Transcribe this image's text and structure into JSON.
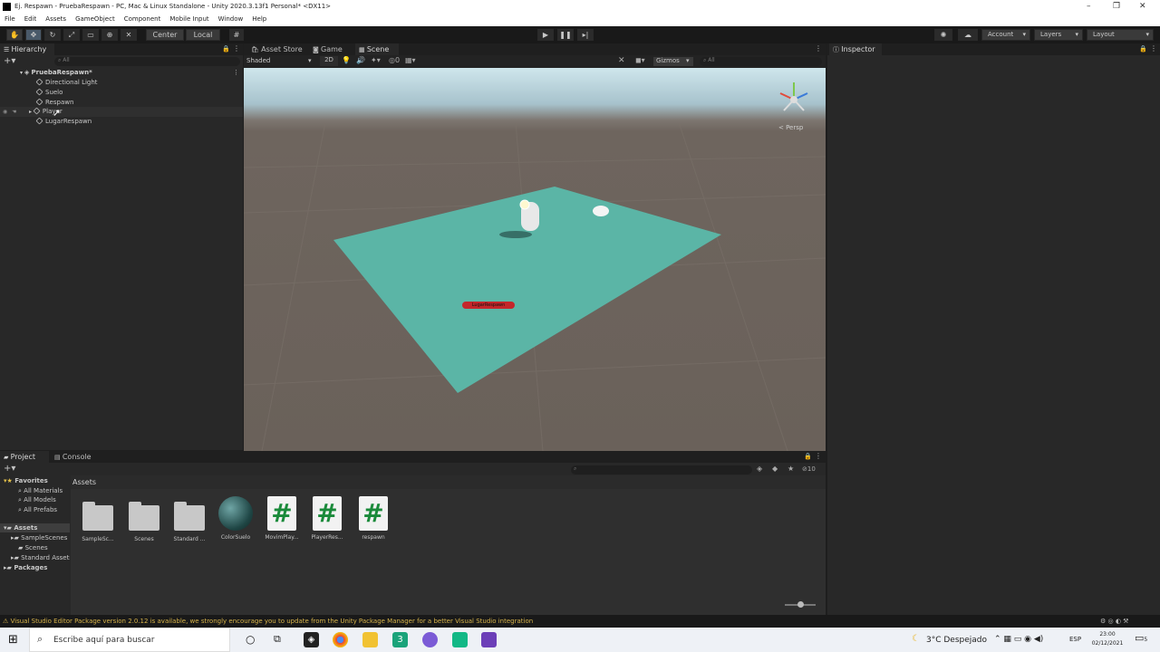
{
  "window": {
    "title": "Ej. Respawn - PruebaRespawn - PC, Mac & Linux Standalone - Unity 2020.3.13f1 Personal* <DX11>",
    "controls": [
      "–",
      "❐",
      "✕"
    ]
  },
  "menu": [
    "File",
    "Edit",
    "Assets",
    "GameObject",
    "Component",
    "Mobile Input",
    "Window",
    "Help"
  ],
  "toolbar": {
    "pivot": "Center",
    "space": "Local",
    "account": "Account",
    "layers": "Layers",
    "layout": "Layout"
  },
  "hierarchy": {
    "tab": "Hierarchy",
    "search_placeholder": "All",
    "scene": "PruebaRespawn*",
    "items": [
      "Directional Light",
      "Suelo",
      "Respawn",
      "Player",
      "LugarRespawn"
    ]
  },
  "scene_tabs": [
    "Asset Store",
    "Game",
    "Scene"
  ],
  "scene_toolbar": {
    "shading": "Shaded",
    "mode": "2D",
    "gizmos": "Gizmos",
    "search_placeholder": "All"
  },
  "scene_view": {
    "persp_label": "< Persp",
    "object_label": "LugarRespawn",
    "colors": {
      "plane": "#5bb5a6",
      "label": "#c4262b"
    }
  },
  "inspector": {
    "tab": "Inspector"
  },
  "project": {
    "tabs": [
      "Project",
      "Console"
    ],
    "favorites": {
      "label": "Favorites",
      "items": [
        "All Materials",
        "All Models",
        "All Prefabs"
      ]
    },
    "assets_root": "Assets",
    "asset_folders": [
      "SampleScenes",
      "Scenes",
      "Standard Assets"
    ],
    "packages": "Packages",
    "breadcrumb": "Assets",
    "badge": "10",
    "assets": [
      {
        "name": "SampleSc...",
        "kind": "folder"
      },
      {
        "name": "Scenes",
        "kind": "folder"
      },
      {
        "name": "Standard ...",
        "kind": "folder"
      },
      {
        "name": "ColorSuelo",
        "kind": "material"
      },
      {
        "name": "MovimPlay...",
        "kind": "script"
      },
      {
        "name": "PlayerRes...",
        "kind": "script"
      },
      {
        "name": "respawn",
        "kind": "script"
      }
    ]
  },
  "status": {
    "message": "Visual Studio Editor Package version 2.0.12 is available, we strongly encourage you to update from the Unity Package Manager for a better Visual Studio integration"
  },
  "taskbar": {
    "search_placeholder": "Escribe aquí para buscar",
    "weather": "3°C  Despejado",
    "lang": "ESP",
    "time": "23:00",
    "date": "02/12/2021",
    "notifications": "5"
  }
}
